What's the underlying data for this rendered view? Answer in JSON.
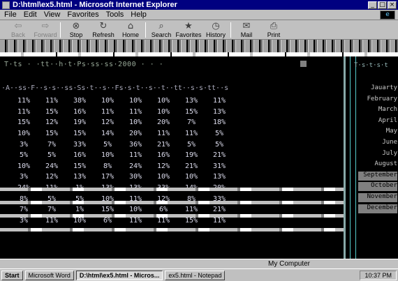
{
  "window": {
    "title": "D:\\html\\ex5.html - Microsoft Internet Explorer"
  },
  "menu": [
    "File",
    "Edit",
    "View",
    "Favorites",
    "Tools",
    "Help"
  ],
  "toolbar": [
    {
      "label": "Back",
      "icon": "back-arrow-icon",
      "glyph": "⇦",
      "dim": true
    },
    {
      "label": "Forward",
      "icon": "forward-arrow-icon",
      "glyph": "⇨",
      "dim": true
    },
    {
      "label": "Stop",
      "icon": "stop-icon",
      "glyph": "⊗",
      "dim": false
    },
    {
      "label": "Refresh",
      "icon": "refresh-icon",
      "glyph": "↻",
      "dim": false
    },
    {
      "label": "Home",
      "icon": "home-icon",
      "glyph": "⌂",
      "dim": false
    },
    {
      "label": "Search",
      "icon": "search-icon",
      "glyph": "⌕",
      "dim": false
    },
    {
      "label": "Favorites",
      "icon": "favorites-icon",
      "glyph": "★",
      "dim": false
    },
    {
      "label": "History",
      "icon": "history-icon",
      "glyph": "◷",
      "dim": false
    },
    {
      "label": "Mail",
      "icon": "mail-icon",
      "glyph": "✉",
      "dim": false
    },
    {
      "label": "Print",
      "icon": "print-icon",
      "glyph": "⎙",
      "dim": false
    }
  ],
  "content": {
    "heading": "T·ts · ·tt··h·t·Ps·ss·ss·2000 · ·  ·",
    "subtitle": "·A··ss·F··s·s··ss·Ss·t··s··Fs·s·t··s··t··tt··s·s·tt··s",
    "grid": [
      [
        "11%",
        "11%",
        "38%",
        "10%",
        "10%",
        "10%",
        "13%",
        "11%"
      ],
      [
        "11%",
        "15%",
        "16%",
        "11%",
        "11%",
        "10%",
        "15%",
        "13%"
      ],
      [
        "15%",
        "12%",
        "19%",
        "12%",
        "10%",
        "20%",
        "7%",
        "18%"
      ],
      [
        "10%",
        "15%",
        "15%",
        "14%",
        "20%",
        "11%",
        "11%",
        "5%"
      ],
      [
        "3%",
        "7%",
        "33%",
        "5%",
        "36%",
        "21%",
        "5%",
        "5%"
      ],
      [
        "5%",
        "5%",
        "16%",
        "10%",
        "11%",
        "16%",
        "19%",
        "21%"
      ],
      [
        "10%",
        "24%",
        "15%",
        "8%",
        "24%",
        "12%",
        "21%",
        "31%"
      ],
      [
        "3%",
        "12%",
        "13%",
        "17%",
        "30%",
        "10%",
        "10%",
        "13%"
      ],
      [
        "24%",
        "11%",
        "1%",
        "13%",
        "13%",
        "33%",
        "14%",
        "20%"
      ],
      [
        "8%",
        "5%",
        "5%",
        "10%",
        "11%",
        "12%",
        "8%",
        "33%"
      ],
      [
        "7%",
        "7%",
        "1%",
        "15%",
        "10%",
        "6%",
        "11%",
        "21%"
      ],
      [
        "3%",
        "11%",
        "10%",
        "6%",
        "11%",
        "11%",
        "15%",
        "11%"
      ]
    ]
  },
  "rightpane": {
    "top_text": "T·s·t·s·t",
    "items": [
      "Jauarty",
      "February",
      "March",
      "April",
      "May",
      "June",
      "July",
      "August",
      "September",
      "October",
      "November",
      "December"
    ]
  },
  "status": {
    "text": "My Computer"
  },
  "taskbar": {
    "start": "Start",
    "tasks": [
      {
        "label": "Microsoft Word",
        "active": false
      },
      {
        "label": "D:\\html\\ex5.html - Micros...",
        "active": true
      },
      {
        "label": "ex5.html - Notepad",
        "active": false
      }
    ],
    "clock": "10:37 PM"
  }
}
